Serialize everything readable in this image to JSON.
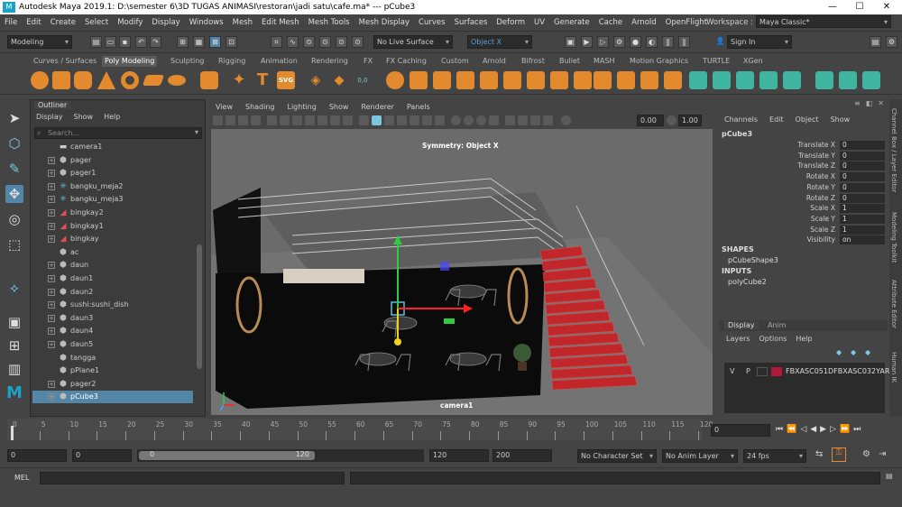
{
  "window": {
    "title": "Autodesk Maya 2019.1: D:\\semester 6\\3D TUGAS ANIMASI\\restoran\\jadi satu\\cafe.ma*   ---   pCube3",
    "icon_letter": "M",
    "controls": [
      "minimize-icon",
      "maximize-icon",
      "close-icon"
    ]
  },
  "menubar": [
    "File",
    "Edit",
    "Create",
    "Select",
    "Modify",
    "Display",
    "Windows",
    "Mesh",
    "Edit Mesh",
    "Mesh Tools",
    "Mesh Display",
    "Curves",
    "Surfaces",
    "Deform",
    "UV",
    "Generate",
    "Cache",
    "Arnold",
    "OpenFlight"
  ],
  "workspace": {
    "label": "Workspace :",
    "value": "Maya Classic*"
  },
  "statusline": {
    "mode": "Modeling",
    "live_surface": "No Live Surface",
    "symmetry": "Object X",
    "sign_in": "Sign In"
  },
  "shelf_tabs": [
    "Curves / Surfaces",
    "Poly Modeling",
    "Sculpting",
    "Rigging",
    "Animation",
    "Rendering",
    "FX",
    "FX Caching",
    "Custom",
    "Arnold",
    "Bifrost",
    "Bullet",
    "MASH",
    "Motion Graphics",
    "TURTLE",
    "XGen"
  ],
  "shelf_active": "Poly Modeling",
  "shelf_icons": [
    "sphere",
    "cube",
    "cylinder",
    "cone",
    "torus",
    "plane",
    "disc",
    "platonic",
    "superellipse",
    "star",
    "type-T",
    "svg",
    "counter",
    "combine",
    "extract",
    "bevel",
    "bridge",
    "extrude",
    "fill-hole",
    "merge",
    "multicut",
    "target-weld",
    "mirror",
    "smooth",
    "reduce",
    "uv-editor",
    "planar-uv",
    "auto-uv",
    "cut-uv",
    "sew-uv",
    "unfold",
    "layout",
    "sculpt"
  ],
  "shelf_icon_text": {
    "type": "T",
    "svg": "SVG",
    "counter": "0,0"
  },
  "outliner": {
    "title": "Outliner",
    "menu": [
      "Display",
      "Show",
      "Help"
    ],
    "search_placeholder": "Search...",
    "items": [
      {
        "label": "camera1",
        "icon": "camera-icon",
        "expand": false
      },
      {
        "label": "pager",
        "icon": "mesh-icon",
        "expand": true
      },
      {
        "label": "pager1",
        "icon": "mesh-icon",
        "expand": true
      },
      {
        "label": "bangku_meja2",
        "icon": "joint-icon",
        "expand": true
      },
      {
        "label": "bangku_meja3",
        "icon": "joint-icon",
        "expand": true
      },
      {
        "label": "bingkay2",
        "icon": "curve-icon",
        "expand": true
      },
      {
        "label": "bingkay1",
        "icon": "curve-icon",
        "expand": true
      },
      {
        "label": "bingkay",
        "icon": "curve-icon",
        "expand": true
      },
      {
        "label": "ac",
        "icon": "mesh-icon",
        "expand": false
      },
      {
        "label": "daun",
        "icon": "mesh-icon",
        "expand": true
      },
      {
        "label": "daun1",
        "icon": "mesh-icon",
        "expand": true
      },
      {
        "label": "daun2",
        "icon": "mesh-icon",
        "expand": true
      },
      {
        "label": "sushi:sushi_dish",
        "icon": "mesh-icon",
        "expand": true
      },
      {
        "label": "daun3",
        "icon": "mesh-icon",
        "expand": true
      },
      {
        "label": "daun4",
        "icon": "mesh-icon",
        "expand": true
      },
      {
        "label": "daun5",
        "icon": "mesh-icon",
        "expand": true
      },
      {
        "label": "tangga",
        "icon": "mesh-icon",
        "expand": false
      },
      {
        "label": "pPlane1",
        "icon": "mesh-icon",
        "expand": false
      },
      {
        "label": "pager2",
        "icon": "mesh-icon",
        "expand": true
      },
      {
        "label": "pCube3",
        "icon": "mesh-icon",
        "expand": true,
        "selected": true
      }
    ]
  },
  "viewport": {
    "menu": [
      "View",
      "Shading",
      "Lighting",
      "Show",
      "Renderer",
      "Panels"
    ],
    "field1": "0.00",
    "field2": "1.00",
    "hud_symmetry": "Symmetry: Object X",
    "camera_label": "camera1"
  },
  "channelbox": {
    "menu": [
      "Channels",
      "Edit",
      "Object",
      "Show"
    ],
    "object": "pCube3",
    "attributes": [
      {
        "name": "Translate X",
        "value": "0"
      },
      {
        "name": "Translate Y",
        "value": "0"
      },
      {
        "name": "Translate Z",
        "value": "0"
      },
      {
        "name": "Rotate X",
        "value": "0"
      },
      {
        "name": "Rotate Y",
        "value": "0"
      },
      {
        "name": "Rotate Z",
        "value": "0"
      },
      {
        "name": "Scale X",
        "value": "1"
      },
      {
        "name": "Scale Y",
        "value": "1"
      },
      {
        "name": "Scale Z",
        "value": "1"
      },
      {
        "name": "Visibility",
        "value": "on"
      }
    ],
    "shapes_header": "SHAPES",
    "shape_name": "pCubeShape3",
    "inputs_header": "INPUTS",
    "input_name": "polyCube2",
    "layer_tabs": [
      "Display",
      "Anim"
    ],
    "layer_menu": [
      "Layers",
      "Options",
      "Help"
    ],
    "layer": {
      "v": "V",
      "p": "P",
      "color": "#b0183a",
      "name": "FBXASC051DFBXASC032YAR"
    }
  },
  "sidetabs": [
    "Channel Box / Layer Editor",
    "Modeling Toolkit",
    "Attribute Editor",
    "Human IK"
  ],
  "timeline": {
    "ticks": [
      "0",
      "5",
      "10",
      "15",
      "20",
      "25",
      "30",
      "35",
      "40",
      "45",
      "50",
      "55",
      "60",
      "65",
      "70",
      "75",
      "80",
      "85",
      "90",
      "95",
      "100",
      "105",
      "110",
      "115",
      "120"
    ],
    "current_frame": "0"
  },
  "range": {
    "start": "0",
    "start_inner": "0",
    "slider_start": "0",
    "slider_end": "120",
    "end_inner": "120",
    "end": "200",
    "character_set": "No Character Set",
    "anim_layer": "No Anim Layer",
    "fps": "24 fps"
  },
  "cmdline": {
    "label": "MEL"
  },
  "colors": {
    "selection": "#5285a6",
    "stairs": "#c0262a",
    "maya_accent": "#19a3c8"
  }
}
